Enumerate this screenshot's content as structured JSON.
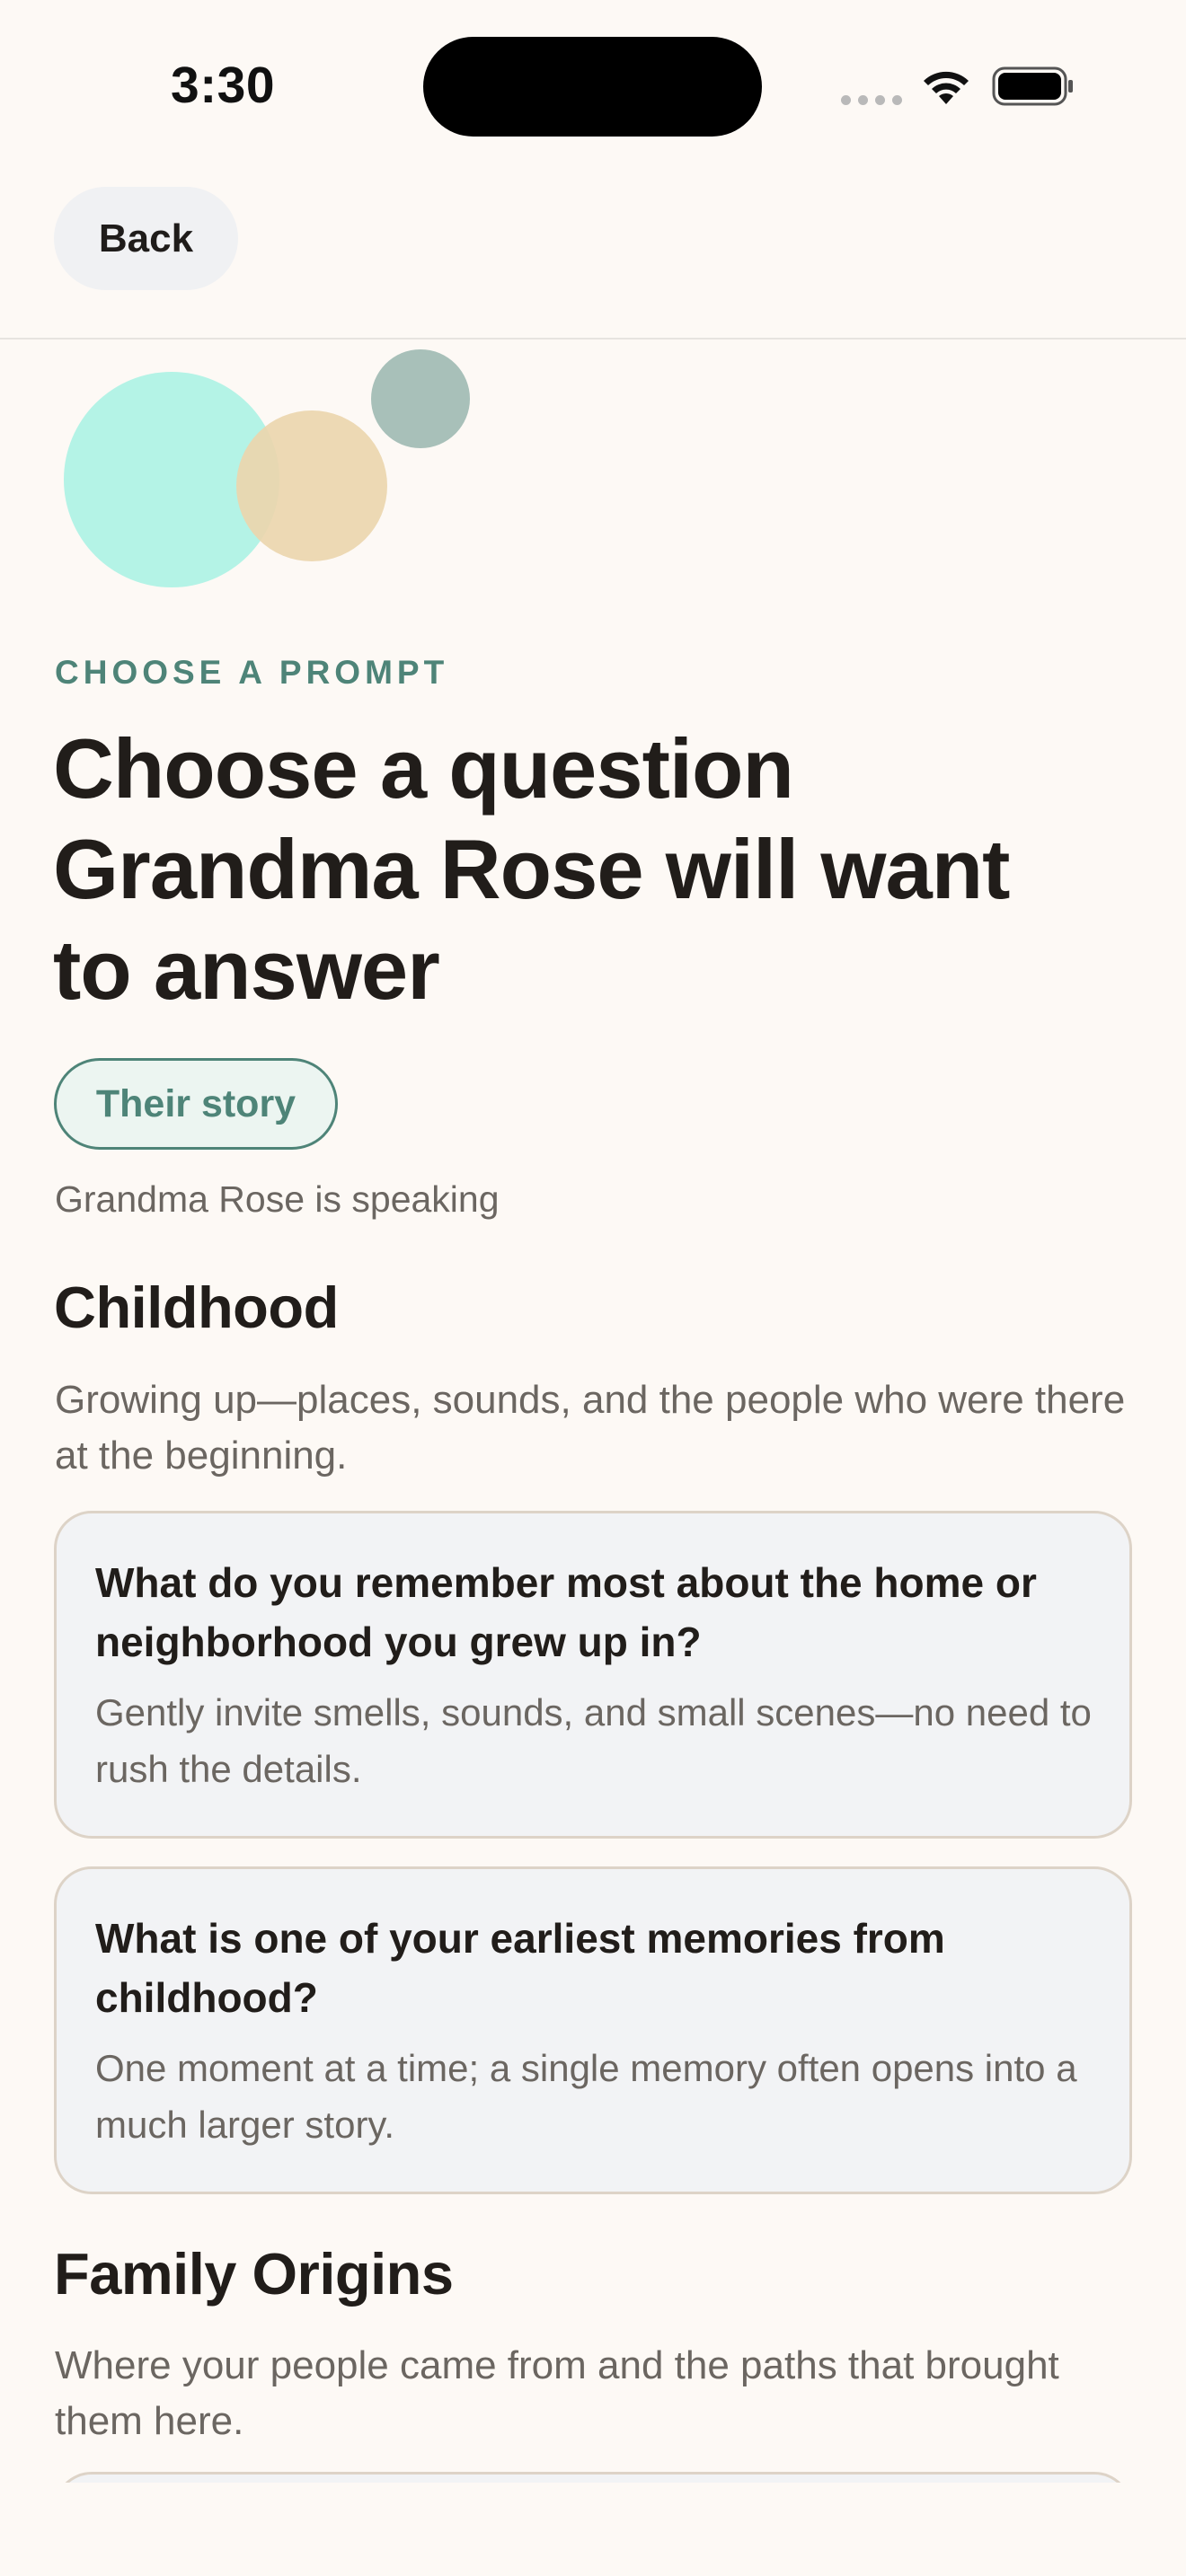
{
  "status_bar": {
    "time": "3:30"
  },
  "header": {
    "back_label": "Back"
  },
  "eyebrow": "CHOOSE A PROMPT",
  "title_lines": [
    "Choose a question",
    "Grandma Rose will want",
    "to answer"
  ],
  "story_chip": "Their story",
  "speaker_note": "Grandma Rose is speaking",
  "sections": [
    {
      "title": "Childhood",
      "description": "Growing up—places, sounds, and the people who were there at the beginning.",
      "prompts": [
        {
          "question": "What do you remember most about the home or neighborhood you grew up in?",
          "hint": "Gently invite smells, sounds, and small scenes—no need to rush the details."
        },
        {
          "question": "What is one of your earliest memories from childhood?",
          "hint": "One moment at a time; a single memory often opens into a much larger story."
        }
      ]
    },
    {
      "title": "Family Origins",
      "description": "Where your people came from and the paths that brought them here.",
      "prompts": []
    }
  ],
  "colors": {
    "background": "#fdf9f5",
    "accent": "#4e8478",
    "card_background": "#f2f3f5",
    "card_border": "#ddd3c7",
    "circle_teal": "#b4f3e6",
    "circle_sand": "#ecd6ae",
    "circle_gray": "#a8c0b9"
  }
}
